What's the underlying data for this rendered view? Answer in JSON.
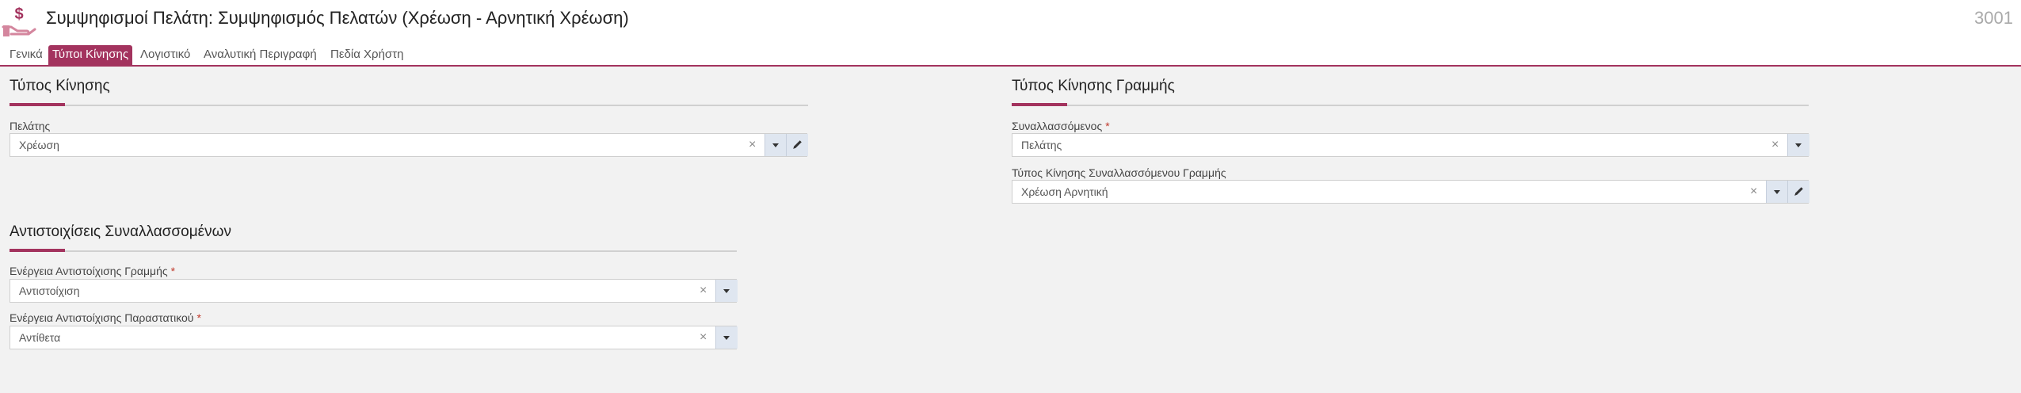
{
  "header": {
    "title": "Συμψηφισμοί Πελάτη: Συμψηφισμός Πελατών (Χρέωση - Αρνητική Χρέωση)",
    "doc_number": "3001",
    "icon": "hand-dollar-icon"
  },
  "tabs": [
    {
      "label": "Γενικά",
      "active": false
    },
    {
      "label": "Τύποι Κίνησης",
      "active": true
    },
    {
      "label": "Λογιστικό",
      "active": false
    },
    {
      "label": "Αναλυτική Περιγραφή",
      "active": false
    },
    {
      "label": "Πεδία Χρήστη",
      "active": false
    }
  ],
  "sections": {
    "movement_type": {
      "title": "Τύπος Κίνησης",
      "customer_label": "Πελάτης",
      "customer_value": "Χρέωση"
    },
    "line_movement_type": {
      "title": "Τύπος Κίνησης Γραμμής",
      "counterparty_label": "Συναλλασσόμενος",
      "counterparty_required": "*",
      "counterparty_value": "Πελάτης",
      "cp_line_type_label": "Τύπος Κίνησης Συναλλασσόμενου Γραμμής",
      "cp_line_type_value": "Χρέωση Αρνητική"
    },
    "counterparty_matching": {
      "title": "Αντιστοιχίσεις Συναλλασσομένων",
      "line_action_label": "Ενέργεια Αντιστοίχισης Γραμμής",
      "line_action_required": "*",
      "line_action_value": "Αντιστοίχιση",
      "doc_action_label": "Ενέργεια Αντιστοίχισης Παραστατικού",
      "doc_action_required": "*",
      "doc_action_value": "Αντίθετα"
    }
  },
  "icons": {
    "clear": "×",
    "dropdown": "chevron-down-icon",
    "edit": "pencil-icon"
  },
  "colors": {
    "accent": "#a3335e",
    "background": "#f2f2f2",
    "button": "#dfe6f0"
  }
}
